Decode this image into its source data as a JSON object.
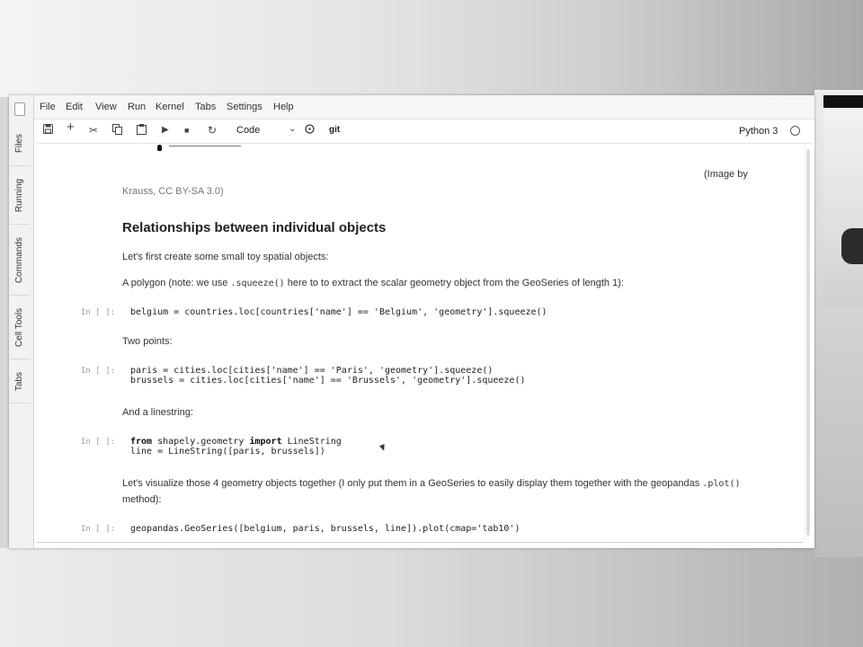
{
  "menu": [
    "File",
    "Edit",
    "View",
    "Run",
    "Kernel",
    "Tabs",
    "Settings",
    "Help"
  ],
  "sidebar_tabs": [
    "Files",
    "Running",
    "Commands",
    "Cell Tools",
    "Tabs"
  ],
  "toolbar": {
    "icons": [
      "save-icon",
      "add-cell-icon",
      "cut-icon",
      "copy-icon",
      "paste-icon",
      "run-icon",
      "stop-icon",
      "restart-icon"
    ],
    "cell_type": "Code",
    "git_label": "git",
    "kernel_name": "Python 3"
  },
  "notebook": {
    "caption_prefix": "(Image by",
    "caption_suffix": "Krauss, CC BY-SA 3.0)",
    "heading": "Relationships between individual objects",
    "intro": "Let's first create some small toy spatial objects:",
    "polygon_note_pre": "A polygon (note: we use ",
    "polygon_note_code": ".squeeze()",
    "polygon_note_post": " here to to extract the scalar geometry object from the GeoSeries of length 1):",
    "prompt": "In [ ]:",
    "cell1": "belgium = countries.loc[countries['name'] == 'Belgium', 'geometry'].squeeze()",
    "two_points": "Two points:",
    "cell2_line1": "paris = cities.loc[cities['name'] == 'Paris', 'geometry'].squeeze()",
    "cell2_line2": "brussels = cities.loc[cities['name'] == 'Brussels', 'geometry'].squeeze()",
    "linestring_text": "And a linestring:",
    "cell3_kw_from": "from",
    "cell3_module": " shapely.geometry ",
    "cell3_kw_import": "import",
    "cell3_name": " LineString",
    "cell3_line2": "line = LineString([paris, brussels])",
    "visualize_pre": "Let's visualize those 4 geometry objects together (I only put them in a GeoSeries to easily display them together with the geopandas ",
    "visualize_code": ".plot()",
    "visualize_post": "method):",
    "cell4": "geopandas.GeoSeries([belgium, paris, brussels, line]).plot(cmap='tab10')"
  }
}
